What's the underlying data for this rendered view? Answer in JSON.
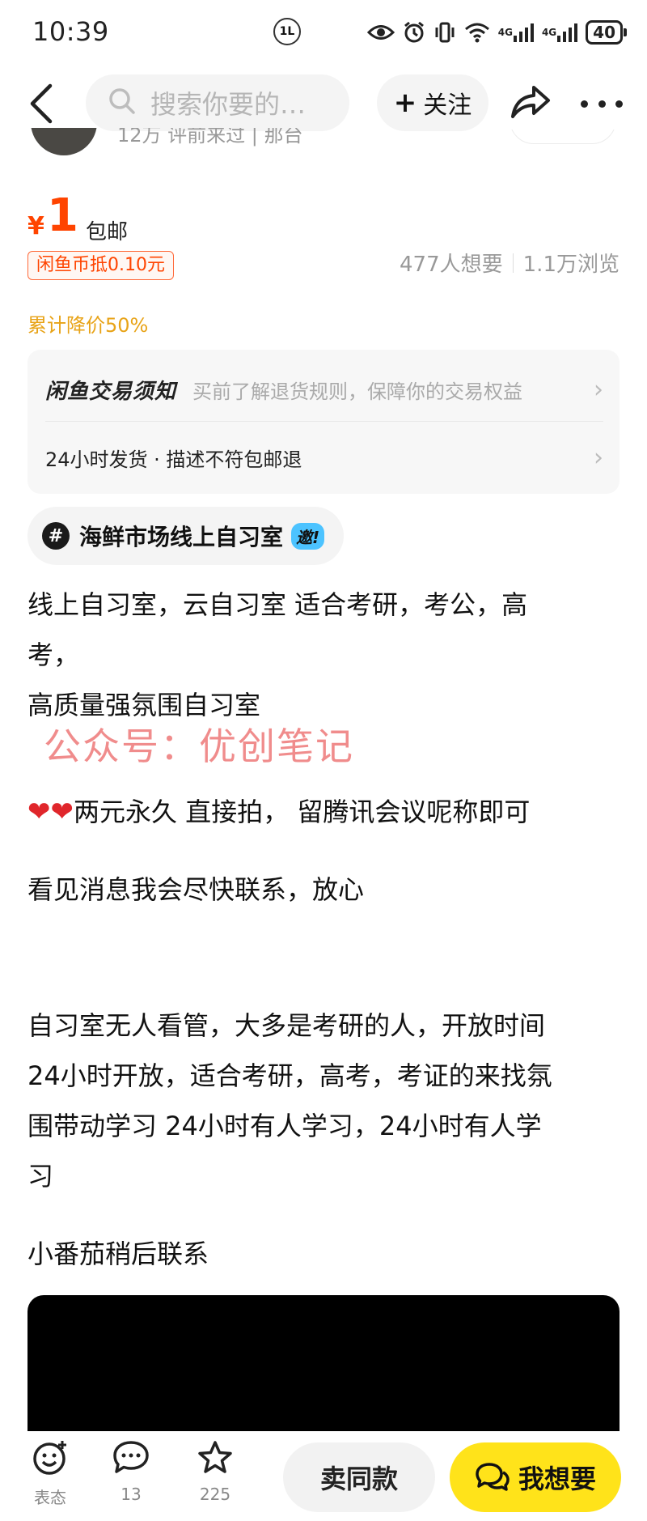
{
  "status_bar": {
    "time": "10:39",
    "badge": "1L",
    "network_1": "4G",
    "network_2": "4G",
    "battery": "40"
  },
  "nav": {
    "search_placeholder": "搜索你要的…",
    "follow_label": "关注",
    "follow_plus": "+"
  },
  "seller": {
    "meta": "12万 评前来过 | 那台"
  },
  "price": {
    "currency_symbol": "¥",
    "value": "1",
    "shipping": "包邮",
    "coin_discount": "闲鱼币抵0.10元",
    "wants": "477人想要",
    "views": "1.1万浏览",
    "total_drop": "累计降价50%"
  },
  "notice": {
    "brand": "闲鱼交易须知",
    "desc": "买前了解退货规则，保障你的交易权益",
    "row2": "24小时发货 · 描述不符包邮退"
  },
  "topic": {
    "hash": "#",
    "text": "海鲜市场线上自习室",
    "invite": "邀!"
  },
  "description": {
    "line1": "线上自习室，云自习室  适合考研，考公，高",
    "line2": "考，",
    "line3": "高质量强氛围自习室",
    "watermark": "公众号：优创笔记",
    "line4": "两元永久  直接拍，  留腾讯会议呢称即可",
    "line5": "看见消息我会尽快联系，放心",
    "line6": "自习室无人看管，大多是考研的人，开放时间",
    "line7": "24小时开放，适合考研，高考，考证的来找氛",
    "line8": "围带动学习   24小时有人学习，24小时有人学",
    "line9": "习",
    "line10": "小番茄稍后联系"
  },
  "bottom_bar": {
    "reaction_label": "表态",
    "comments_count": "13",
    "favorites_count": "225",
    "same_label": "卖同款",
    "want_label": "我想要"
  },
  "colors": {
    "price": "#ff4400",
    "drop": "#e8a317",
    "want_button": "#ffe31a",
    "watermark": "#f08c8c"
  }
}
